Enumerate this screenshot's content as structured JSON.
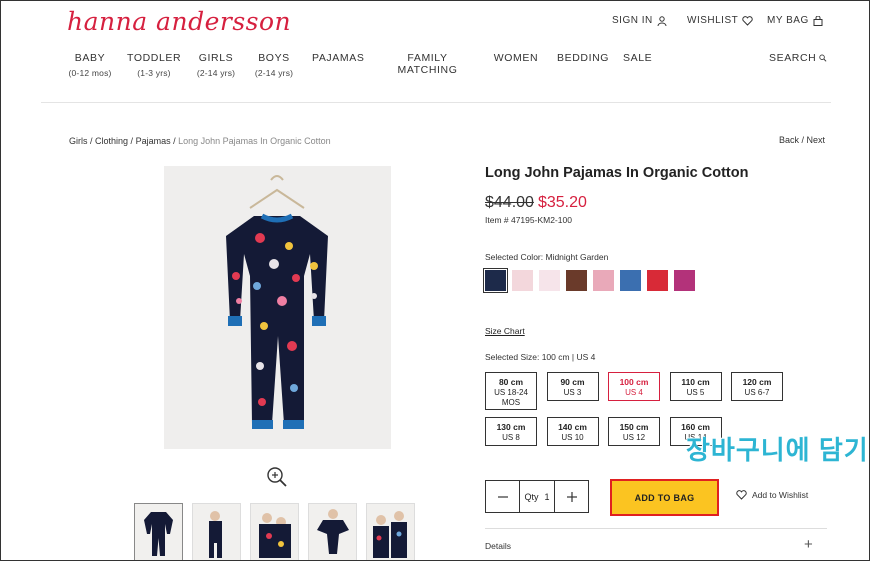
{
  "brand": {
    "logo_text": "hanna andersson",
    "accent": "#d6203f"
  },
  "header": {
    "sign_in": "SIGN IN",
    "wishlist": "WISHLIST",
    "my_bag": "MY BAG"
  },
  "nav": {
    "items": [
      {
        "label": "BABY",
        "sub": "(0-12 mos)"
      },
      {
        "label": "TODDLER",
        "sub": "(1-3 yrs)"
      },
      {
        "label": "GIRLS",
        "sub": "(2-14 yrs)"
      },
      {
        "label": "BOYS",
        "sub": "(2-14 yrs)"
      },
      {
        "label": "PAJAMAS",
        "sub": ""
      },
      {
        "label": "FAMILY MATCHING",
        "sub": ""
      },
      {
        "label": "WOMEN",
        "sub": ""
      },
      {
        "label": "BEDDING",
        "sub": ""
      },
      {
        "label": "SALE",
        "sub": ""
      }
    ],
    "search": "SEARCH"
  },
  "breadcrumb": {
    "items": [
      "Girls",
      "Clothing",
      "Pajamas"
    ],
    "current": "Long John Pajamas In Organic Cotton"
  },
  "pager": {
    "back": "Back",
    "next": "Next"
  },
  "product": {
    "title": "Long John Pajamas In Organic Cotton",
    "old_price": "$44.00",
    "price": "$35.20",
    "item_no": "Item # 47195-KM2-100",
    "selected_color": "Selected Color: Midnight Garden",
    "colors": [
      "#1d2a4a",
      "#f3d7dc",
      "#f6e4ea",
      "#6a3a2a",
      "#e9a9b9",
      "#3b6fb0",
      "#d82a37",
      "#b3327a"
    ],
    "size_chart": "Size Chart",
    "selected_size": "Selected Size: 100 cm | US 4",
    "sizes": [
      {
        "cm": "80 cm",
        "us": "US 18-24 MOS",
        "selected": false
      },
      {
        "cm": "90 cm",
        "us": "US 3",
        "selected": false
      },
      {
        "cm": "100 cm",
        "us": "US 4",
        "selected": true
      },
      {
        "cm": "110 cm",
        "us": "US 5",
        "selected": false
      },
      {
        "cm": "120 cm",
        "us": "US 6-7",
        "selected": false
      },
      {
        "cm": "130 cm",
        "us": "US 8",
        "selected": false
      },
      {
        "cm": "140 cm",
        "us": "US 10",
        "selected": false
      },
      {
        "cm": "150 cm",
        "us": "US 12",
        "selected": false
      },
      {
        "cm": "160 cm",
        "us": "US 14",
        "selected": false
      }
    ],
    "qty_label": "Qty",
    "qty_value": "1",
    "add_to_bag": "ADD TO BAG",
    "add_to_wishlist": "Add to Wishlist",
    "details": "Details"
  },
  "overlay": {
    "annotation": "장바구니에 담기"
  }
}
